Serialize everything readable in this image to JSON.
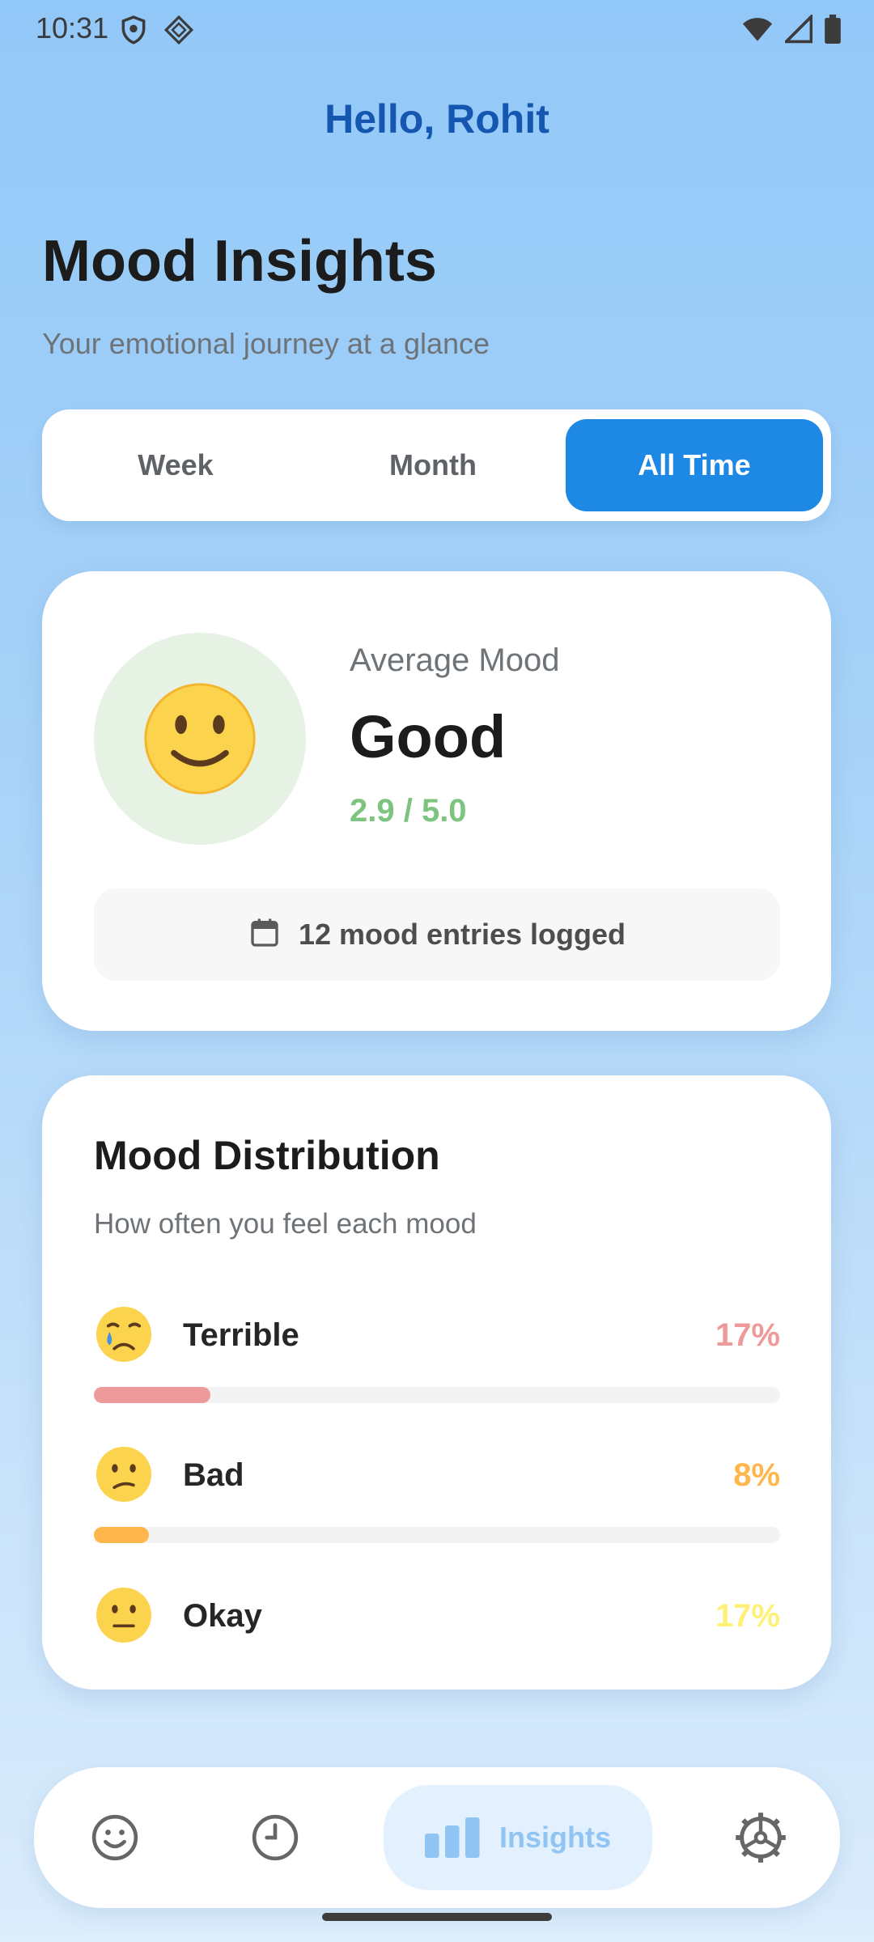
{
  "status_bar": {
    "time": "10:31",
    "left_icons": [
      "shield-icon",
      "diamond-badge-icon"
    ],
    "right_icons": [
      "wifi-icon",
      "signal-icon",
      "battery-icon"
    ]
  },
  "greeting": "Hello, Rohit",
  "page": {
    "title": "Mood Insights",
    "subtitle": "Your emotional journey at a glance"
  },
  "tabs": [
    {
      "label": "Week",
      "selected": false
    },
    {
      "label": "Month",
      "selected": false
    },
    {
      "label": "All Time",
      "selected": true
    }
  ],
  "average_card": {
    "emoji": "slightly-smiling-face",
    "label": "Average Mood",
    "value": "Good",
    "score": "2.9 / 5.0",
    "entries_icon": "calendar-icon",
    "entries_text": "12 mood entries logged"
  },
  "distribution": {
    "title": "Mood Distribution",
    "subtitle": "How often you feel each mood",
    "items": [
      {
        "emoji": "crying-face",
        "label": "Terrible",
        "percent_text": "17%",
        "percent": 17,
        "color": "#ef9a9a"
      },
      {
        "emoji": "confused-face",
        "label": "Bad",
        "percent_text": "8%",
        "percent": 8,
        "color": "#ffb74d"
      },
      {
        "emoji": "neutral-face",
        "label": "Okay",
        "percent_text": "17%",
        "percent": 17,
        "color": "#fff176"
      }
    ]
  },
  "bottom_nav": {
    "items": [
      {
        "icon": "smiley-icon",
        "label": "",
        "selected": false
      },
      {
        "icon": "clock-icon",
        "label": "",
        "selected": false
      },
      {
        "icon": "bar-chart-icon",
        "label": "Insights",
        "selected": true
      },
      {
        "icon": "settings-wheel-icon",
        "label": "",
        "selected": false
      }
    ]
  },
  "colors": {
    "accent": "#1e88e5",
    "greeting": "#1557b0",
    "score": "#7cc47f"
  }
}
